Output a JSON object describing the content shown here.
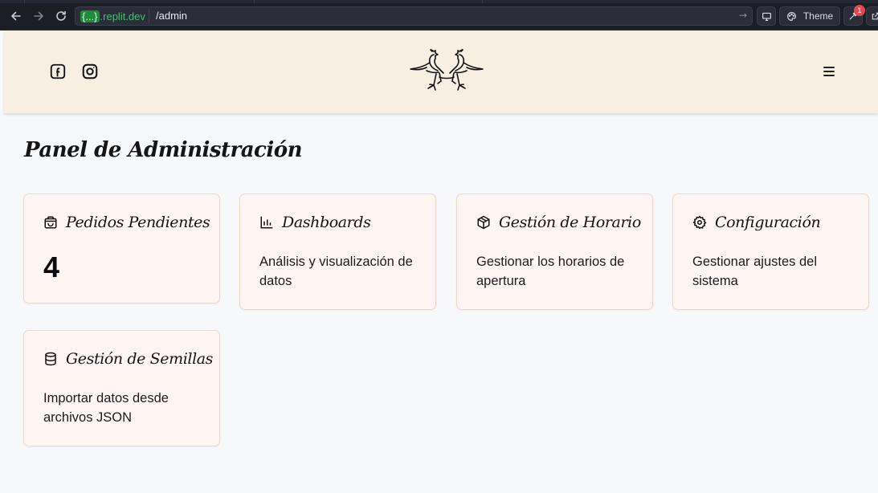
{
  "browser": {
    "url_host_brace": "{...}",
    "url_host": ".replit.dev",
    "url_path": "/admin",
    "theme_label": "Theme",
    "notification_count": "1"
  },
  "header": {
    "social": [
      {
        "icon": "facebook-icon"
      },
      {
        "icon": "instagram-icon"
      }
    ],
    "logo": "roosters-logo",
    "menu_icon": "hamburger-menu-icon"
  },
  "main": {
    "title": "Panel de Administración",
    "cards": [
      {
        "icon": "shopping-bag-icon",
        "title": "Pedidos Pendientes",
        "count": "4"
      },
      {
        "icon": "bar-chart-icon",
        "title": "Dashboards",
        "description": "Análisis y visualización de datos"
      },
      {
        "icon": "package-icon",
        "title": "Gestión de Horario",
        "description": "Gestionar los horarios de apertura"
      },
      {
        "icon": "gear-icon",
        "title": "Configuración",
        "description": "Gestionar ajustes del sistema"
      },
      {
        "icon": "database-icon",
        "title": "Gestión de Semillas",
        "description": "Importar datos desde archivos JSON"
      }
    ]
  },
  "colors": {
    "header_bg": "#f8efe3",
    "card_bg": "#fff6f3",
    "card_border": "#f5d3c7",
    "page_bg": "#f7f8fa"
  }
}
